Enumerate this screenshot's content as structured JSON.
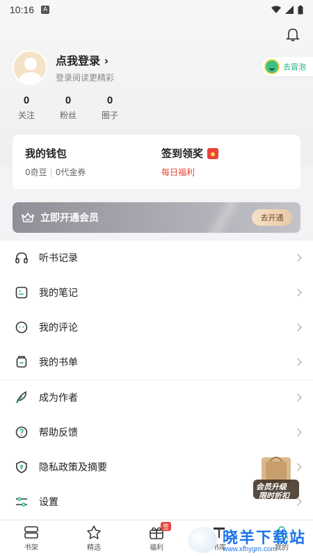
{
  "status_bar": {
    "time": "10:16",
    "a_icon": "A"
  },
  "profile": {
    "login_title": "点我登录",
    "login_subtitle": "登录阅读更精彩",
    "bubble_button": "去冒泡"
  },
  "stats": [
    {
      "value": "0",
      "label": "关注"
    },
    {
      "value": "0",
      "label": "粉丝"
    },
    {
      "value": "0",
      "label": "圈子"
    }
  ],
  "wallet": {
    "title": "我的钱包",
    "qidou": "0奇豆",
    "coupon": "0代金券",
    "checkin_title": "签到领奖",
    "checkin_sub": "每日福利"
  },
  "vip": {
    "label": "立即开通会员",
    "button": "去开通"
  },
  "menu_group1": [
    {
      "label": "听书记录",
      "icon": "headphones-icon"
    },
    {
      "label": "我的笔记",
      "icon": "note-icon"
    },
    {
      "label": "我的评论",
      "icon": "comment-icon"
    },
    {
      "label": "我的书单",
      "icon": "booklist-icon"
    }
  ],
  "menu_group2": [
    {
      "label": "成为作者",
      "icon": "feather-icon"
    },
    {
      "label": "帮助反馈",
      "icon": "help-icon"
    },
    {
      "label": "隐私政策及摘要",
      "icon": "shield-icon"
    },
    {
      "label": "设置",
      "icon": "settings-icon"
    }
  ],
  "promo": {
    "line1": "会员升级",
    "line2": "限时折扣"
  },
  "tabs": [
    {
      "label": "书架",
      "icon": "bookshelf-icon"
    },
    {
      "label": "精选",
      "icon": "star-icon"
    },
    {
      "label": "福利",
      "icon": "gift-icon",
      "badge": "签"
    },
    {
      "label": "书库",
      "icon": "library-icon"
    },
    {
      "label": "我的",
      "icon": "user-icon"
    }
  ],
  "watermark": {
    "title": "晓羊下载站",
    "url": "www.xfhygm.com"
  },
  "colors": {
    "accent_green": "#1db37a",
    "red": "#e8443a",
    "vip_gold": "#e8c9a3"
  }
}
